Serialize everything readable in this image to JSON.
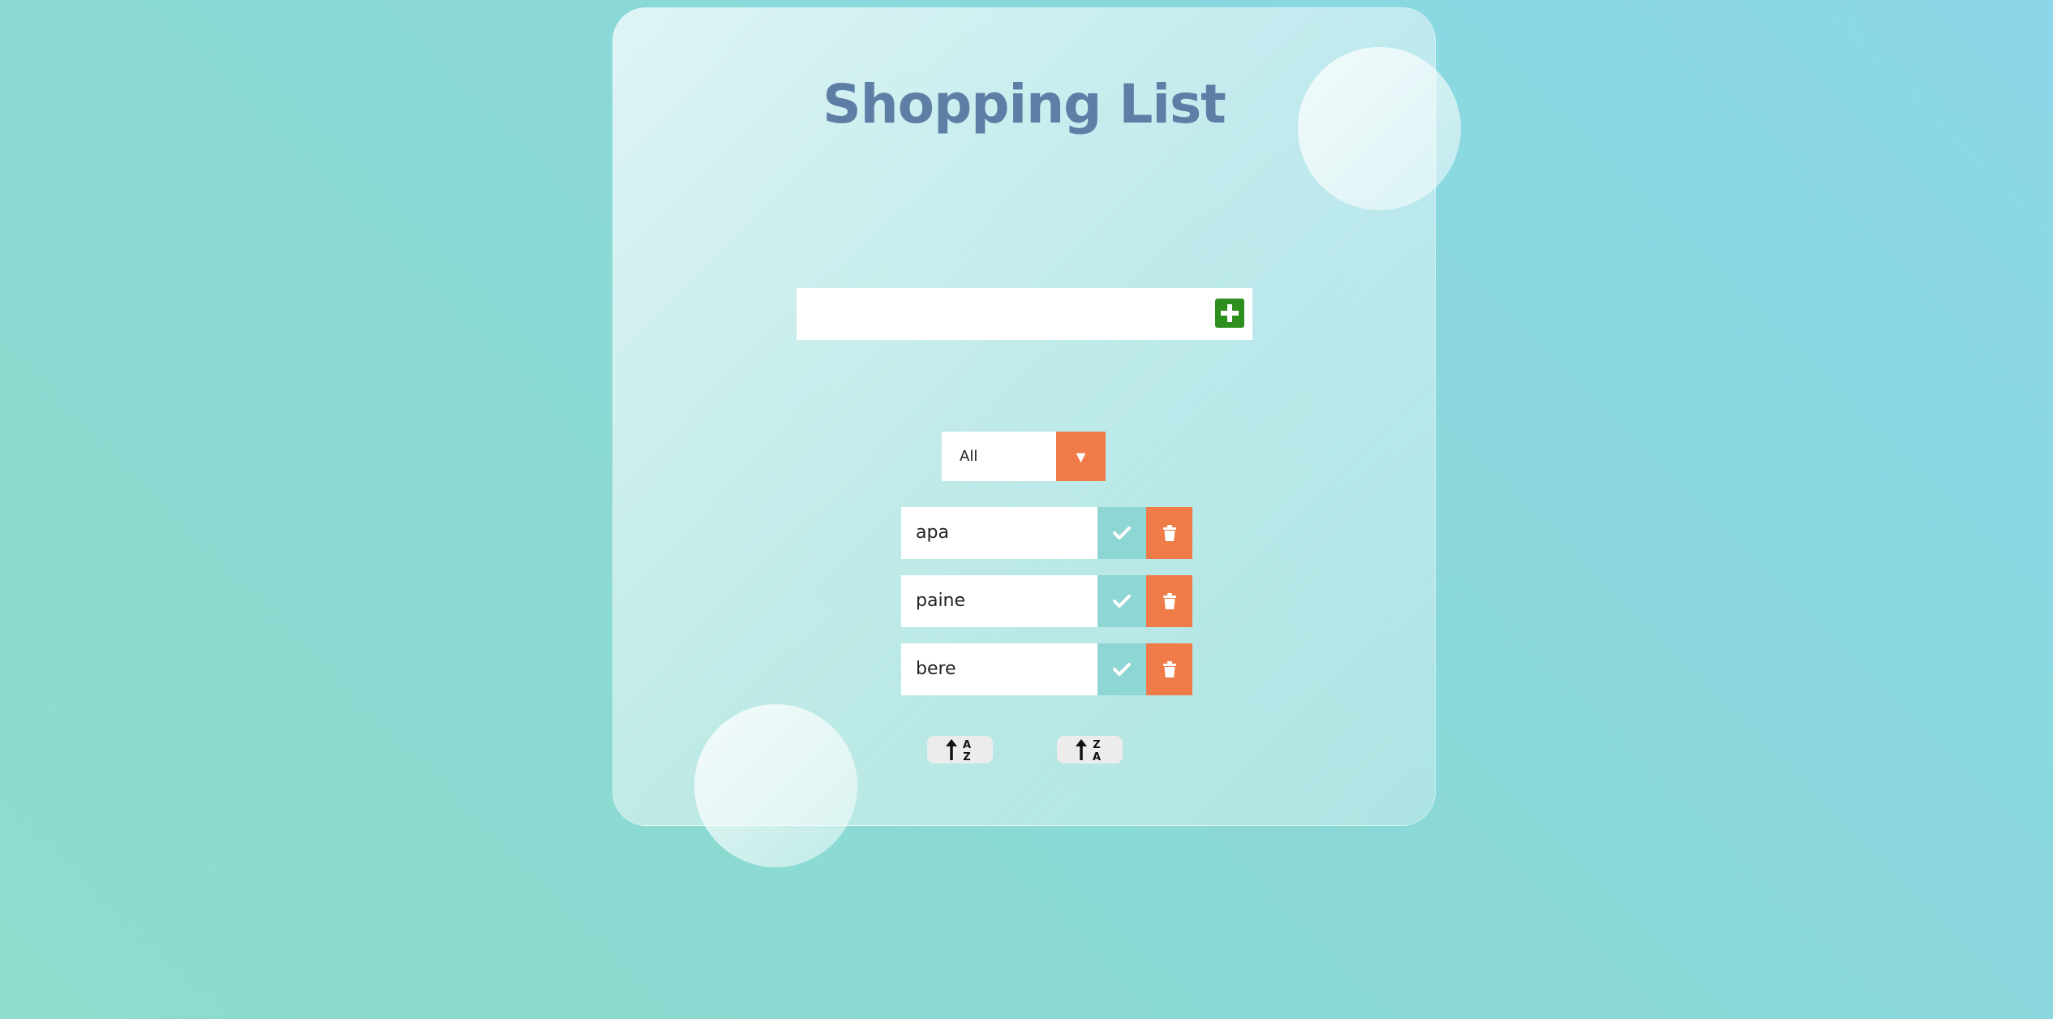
{
  "app": {
    "title": "Shopping List"
  },
  "add_form": {
    "input_value": "",
    "input_placeholder": "",
    "add_icon": "plus-square-icon",
    "add_color": "#2f8f1e"
  },
  "filter": {
    "selected": "All",
    "arrow_glyph": "▼",
    "arrow_icon": "caret-down-icon",
    "accent_color": "#ef7c48"
  },
  "items": [
    {
      "label": "apa"
    },
    {
      "label": "paine"
    },
    {
      "label": "bere"
    }
  ],
  "item_actions": {
    "complete_icon": "check-icon",
    "complete_color": "#8ed6d3",
    "delete_icon": "trash-icon",
    "delete_color": "#ef7c48"
  },
  "sort": {
    "ascending_icon": "sort-alpha-up-icon",
    "ascending_letters": [
      "A",
      "Z"
    ],
    "descending_icon": "sort-alpha-down-alt-icon",
    "descending_letters": [
      "Z",
      "A"
    ]
  },
  "colors": {
    "title": "#5e7ea6",
    "background_start": "#8ddccc",
    "background_end": "#8bd7e8"
  }
}
